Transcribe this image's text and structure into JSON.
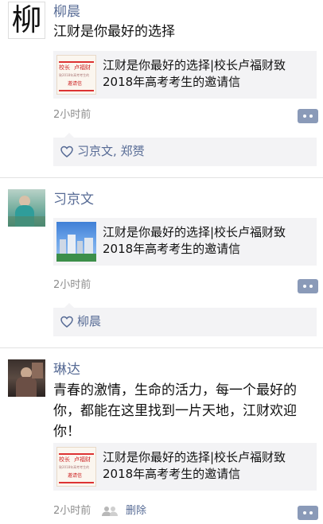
{
  "posts": [
    {
      "author": "柳晨",
      "text": "江财是你最好的选择",
      "card_title": "江财是你最好的选择|校长卢福财致2018年高考考生的邀请信",
      "time": "2小时前",
      "likes": "习京文, 郑赟"
    },
    {
      "author": "习京文",
      "card_title": "江财是你最好的选择|校长卢福财致2018年高考考生的邀请信",
      "time": "2小时前",
      "likes": "柳晨"
    },
    {
      "author": "琳达",
      "text": "青春的激情，生命的活力，每一个最好的你，都能在这里找到一片天地，江财欢迎你！",
      "card_title": "江财是你最好的选择|校长卢福财致2018年高考考生的邀请信",
      "time": "2小时前",
      "delete_label": "删除"
    }
  ],
  "avatar_glyph": "柳",
  "thumb_text": {
    "line1a": "校长",
    "line1b": "卢福财",
    "line2": "致2018年高考考生的",
    "line3": "邀请信"
  },
  "icons": [
    "heart-icon",
    "more-icon",
    "people-icon"
  ],
  "colors": {
    "link": "#576b95",
    "card_bg": "#f3f3f5",
    "more_btn": "#8a9ab8",
    "time": "#8e8e8e"
  }
}
